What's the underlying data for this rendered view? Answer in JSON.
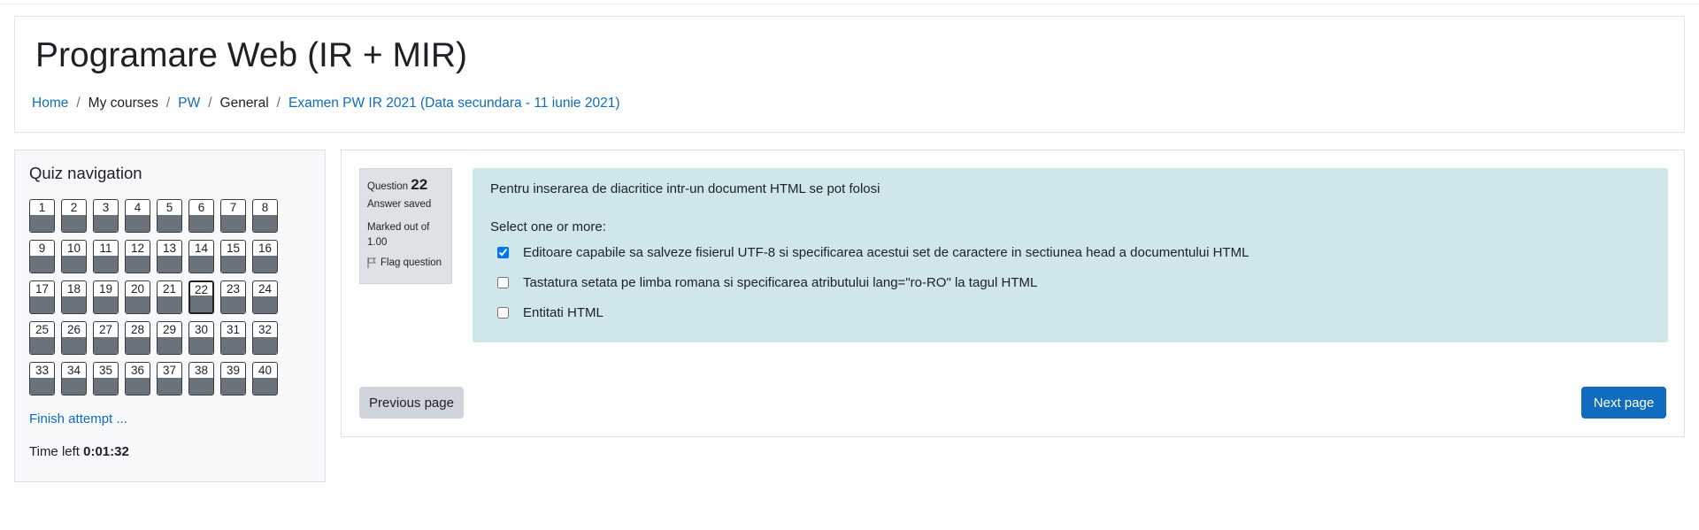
{
  "header": {
    "title": "Programare Web (IR + MIR)",
    "breadcrumb": [
      {
        "label": "Home",
        "link": true
      },
      {
        "label": "My courses",
        "link": false
      },
      {
        "label": "PW",
        "link": true
      },
      {
        "label": "General",
        "link": false
      },
      {
        "label": "Examen PW IR 2021 (Data secundara - 11 iunie 2021)",
        "link": true
      }
    ]
  },
  "quiz_nav": {
    "title": "Quiz navigation",
    "questions": [
      "1",
      "2",
      "3",
      "4",
      "5",
      "6",
      "7",
      "8",
      "9",
      "10",
      "11",
      "12",
      "13",
      "14",
      "15",
      "16",
      "17",
      "18",
      "19",
      "20",
      "21",
      "22",
      "23",
      "24",
      "25",
      "26",
      "27",
      "28",
      "29",
      "30",
      "31",
      "32",
      "33",
      "34",
      "35",
      "36",
      "37",
      "38",
      "39",
      "40"
    ],
    "current": "22",
    "finish_label": "Finish attempt ...",
    "time_label": "Time left",
    "time_value": "0:01:32"
  },
  "question": {
    "label": "Question",
    "number": "22",
    "state": "Answer saved",
    "grade": "Marked out of 1.00",
    "flag_label": "Flag question",
    "text": "Pentru inserarea de diacritice intr-un document HTML se pot folosi",
    "prompt": "Select one or more:",
    "answers": [
      {
        "label": "Editoare capabile sa salveze fisierul UTF-8 si specificarea acestui set de caractere in sectiunea head a documentului HTML",
        "checked": true
      },
      {
        "label": "Tastatura setata pe limba romana si specificarea atributului lang=\"ro-RO\" la tagul HTML",
        "checked": false
      },
      {
        "label": "Entitati HTML",
        "checked": false
      }
    ]
  },
  "buttons": {
    "previous": "Previous page",
    "next": "Next page"
  },
  "colors": {
    "accent": "#0f6cbf",
    "answer_bg": "#cfe6ea",
    "answered_fill": "#6a737b"
  }
}
